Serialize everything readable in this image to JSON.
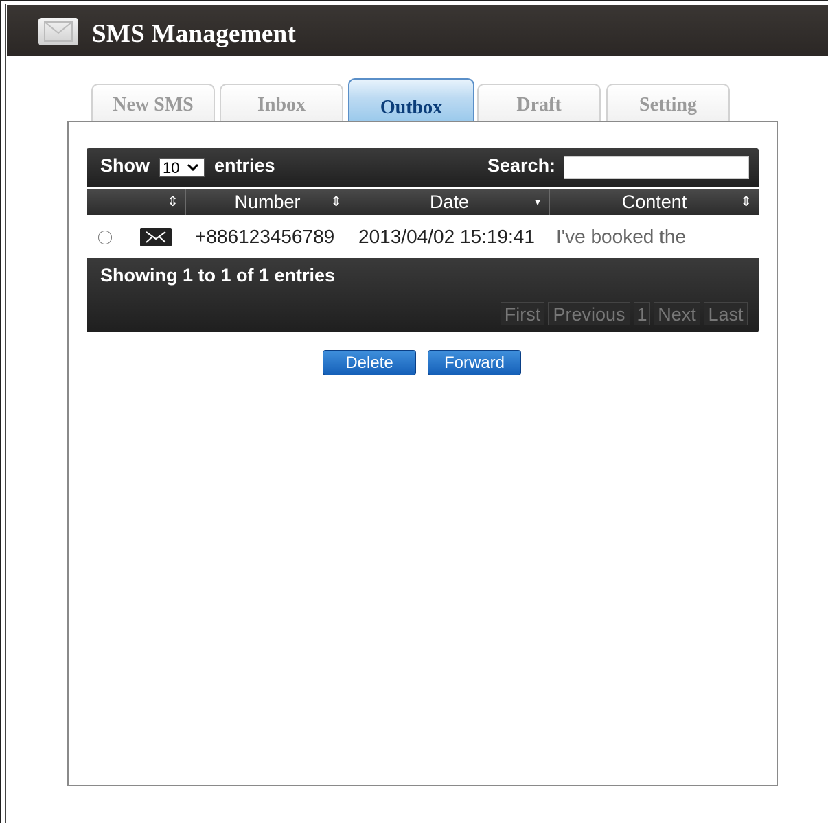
{
  "header": {
    "title": "SMS Management",
    "icon": "envelope-icon"
  },
  "tabs": [
    {
      "label": "New SMS",
      "active": false
    },
    {
      "label": "Inbox",
      "active": false
    },
    {
      "label": "Outbox",
      "active": true
    },
    {
      "label": "Draft",
      "active": false
    },
    {
      "label": "Setting",
      "active": false
    }
  ],
  "table": {
    "length": {
      "show_label": "Show",
      "value": "10",
      "entries_label": "entries"
    },
    "search": {
      "label": "Search:",
      "value": ""
    },
    "columns": [
      "",
      "Number",
      "Date",
      "Content"
    ],
    "sort_icons": {
      "sortable": "⇕",
      "sorted_desc": "▼"
    },
    "rows": [
      {
        "number": "+886123456789",
        "date": "2013/04/02 15:19:41",
        "content": "I've booked the",
        "icon": "sent-message-icon"
      }
    ],
    "info": "Showing 1 to 1 of 1 entries",
    "pagination": [
      "First",
      "Previous",
      "1",
      "Next",
      "Last"
    ]
  },
  "actions": {
    "delete_label": "Delete",
    "forward_label": "Forward"
  },
  "colors": {
    "titlebar": "#2b2725",
    "active_tab": "#9ccaec",
    "button": "#1560b8"
  }
}
